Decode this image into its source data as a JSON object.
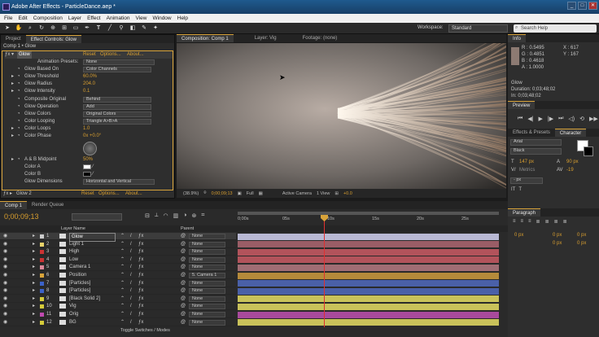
{
  "app": {
    "title": "Adobe After Effects - ParticleDance.aep *"
  },
  "menu": [
    "File",
    "Edit",
    "Composition",
    "Layer",
    "Effect",
    "Animation",
    "View",
    "Window",
    "Help"
  ],
  "toolbar": {
    "workspace_label": "Workspace:",
    "workspace_value": "Standard",
    "search_placeholder": "Search Help"
  },
  "left_panel": {
    "tabs": [
      "Project",
      "Effect Controls: Glow"
    ],
    "breadcrumb": "Comp 1 • Glow",
    "effect": {
      "name": "Glow",
      "links": [
        "Reset",
        "Options...",
        "About..."
      ],
      "presets_label": "Animation Presets:",
      "presets_value": "None",
      "props": [
        {
          "label": "Glow Based On",
          "value": "Color Channels",
          "kind": "dd"
        },
        {
          "label": "Glow Threshold",
          "value": "60.0%",
          "kind": "num"
        },
        {
          "label": "Glow Radius",
          "value": "204.0",
          "kind": "num"
        },
        {
          "label": "Glow Intensity",
          "value": "0.1",
          "kind": "num"
        },
        {
          "label": "Composite Original",
          "value": "Behind",
          "kind": "dd"
        },
        {
          "label": "Glow Operation",
          "value": "Add",
          "kind": "dd"
        },
        {
          "label": "Glow Colors",
          "value": "Original Colors",
          "kind": "dd"
        },
        {
          "label": "Color Looping",
          "value": "Triangle A>B>A",
          "kind": "dd"
        },
        {
          "label": "Color Loops",
          "value": "1.0",
          "kind": "num"
        },
        {
          "label": "Color Phase",
          "value": "0x +0.0°",
          "kind": "num"
        }
      ],
      "midpoint": {
        "label": "A & B Midpoint",
        "value": "50%"
      },
      "color_a": {
        "label": "Color A",
        "color": "#ffffff"
      },
      "color_b": {
        "label": "Color B",
        "color": "#000000"
      },
      "dimensions": {
        "label": "Glow Dimensions",
        "value": "Horizontal and Vertical"
      }
    },
    "glow2": {
      "name": "Glow 2",
      "links": [
        "Reset",
        "Options...",
        "About..."
      ]
    }
  },
  "viewer": {
    "tabs": [
      "Composition: Comp 1",
      "Layer: Vig",
      "Footage: (none)"
    ],
    "zoom": "(38.9%)",
    "timecode": "0;00;09;13",
    "resolution": "Full",
    "camera": "Active Camera",
    "view": "1 View",
    "exposure": "+0.0"
  },
  "info_panel": {
    "title": "Info",
    "r": "R : 0.5495",
    "g": "G : 0.4851",
    "b": "B : 0.4618",
    "a": "A : 1.0000",
    "x": "X : 617",
    "y": "Y : 167",
    "layer": "Glow",
    "duration": "Duration: 0;03;48;02",
    "in": "In: 0;03;48;02"
  },
  "preview_panel": {
    "title": "Preview"
  },
  "char_panel": {
    "tabs": [
      "Effects & Presets",
      "Character"
    ],
    "font": "Arial",
    "style": "Black",
    "size": "147 px",
    "leading": "90 px",
    "kerning": "Metrics",
    "tracking": "-19",
    "unit": "- px"
  },
  "para_panel": {
    "title": "Paragraph",
    "vals": [
      "0 px",
      "0 px",
      "0 px",
      "0 px",
      "0 px"
    ]
  },
  "timeline": {
    "tabs": [
      "Comp 1",
      "Render Queue"
    ],
    "timecode": "0;00;09;13",
    "ticks": [
      "0;00s",
      "05s",
      "10s",
      "15s",
      "20s",
      "25s"
    ],
    "col_layer": "Layer Name",
    "col_parent": "Parent",
    "footer": "Toggle Switches / Modes",
    "layers": [
      {
        "num": "1",
        "name": "Glow",
        "parent": "None",
        "color": "#b9b9d4",
        "swatch": "#cccccc",
        "selected": true
      },
      {
        "num": "2",
        "name": "Light 1",
        "parent": "None",
        "color": "#9a5d66",
        "swatch": "#e8d26a"
      },
      {
        "num": "3",
        "name": "High",
        "parent": "None",
        "color": "#b2535b",
        "swatch": "#cc3333"
      },
      {
        "num": "4",
        "name": "Low",
        "parent": "None",
        "color": "#b2535b",
        "swatch": "#cc3333"
      },
      {
        "num": "5",
        "name": "Camera 1",
        "parent": "None",
        "color": "#a06d74",
        "swatch": "#dd8899"
      },
      {
        "num": "6",
        "name": "Position",
        "parent": "5. Camera 1",
        "color": "#b58a3a",
        "swatch": "#d9a43a"
      },
      {
        "num": "7",
        "name": "[Particles]",
        "parent": "None",
        "color": "#4a60a8",
        "swatch": "#3b62c9"
      },
      {
        "num": "8",
        "name": "[Particles]",
        "parent": "None",
        "color": "#4a60a8",
        "swatch": "#3b62c9"
      },
      {
        "num": "9",
        "name": "[Black Solid 2]",
        "parent": "None",
        "color": "#c9c25a",
        "swatch": "#d6cc3a"
      },
      {
        "num": "10",
        "name": "Vig",
        "parent": "None",
        "color": "#c9c25a",
        "swatch": "#d6cc3a"
      },
      {
        "num": "11",
        "name": "Orig",
        "parent": "None",
        "color": "#a84a9c",
        "swatch": "#c04ab0"
      },
      {
        "num": "12",
        "name": "BG",
        "parent": "None",
        "color": "#c9c25a",
        "swatch": "#d6cc3a"
      }
    ]
  }
}
